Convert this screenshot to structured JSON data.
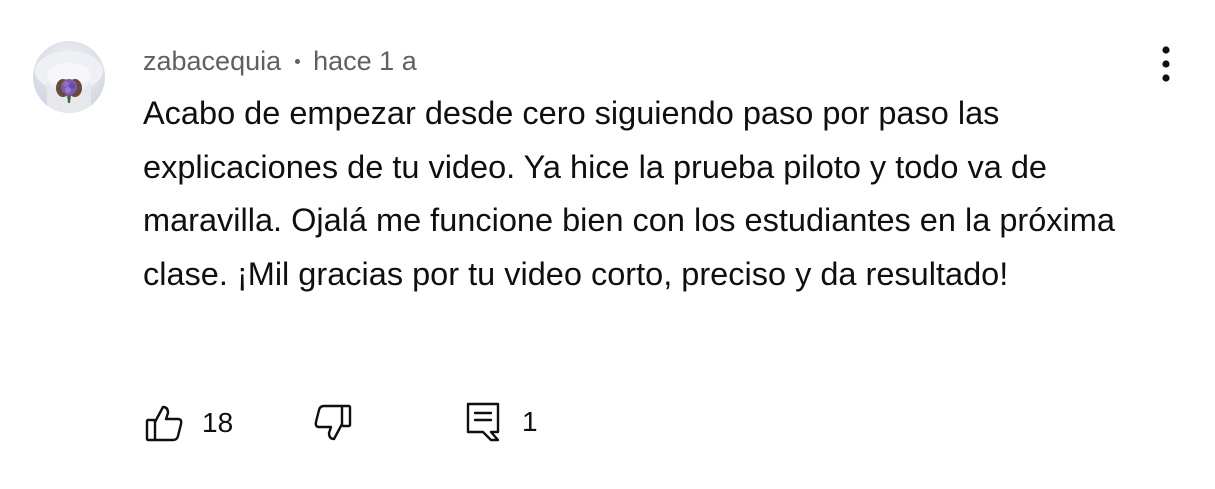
{
  "comment": {
    "author": "zabacequia",
    "time": "hace 1 a",
    "text": "Acabo de empezar desde cero siguiendo paso por paso las explicaciones de tu video. Ya hice la prueba piloto y todo va de maravilla. Ojalá me funcione bien con los estudiantes en la próxima clase. ¡Mil gracias por tu video corto, preciso y da resultado!",
    "like_count": "18",
    "reply_count": "1"
  },
  "icons": {
    "avatar": "avatar-image",
    "more": "more-vertical-icon",
    "like": "thumbs-up-icon",
    "dislike": "thumbs-down-icon",
    "reply": "comment-reply-icon"
  }
}
